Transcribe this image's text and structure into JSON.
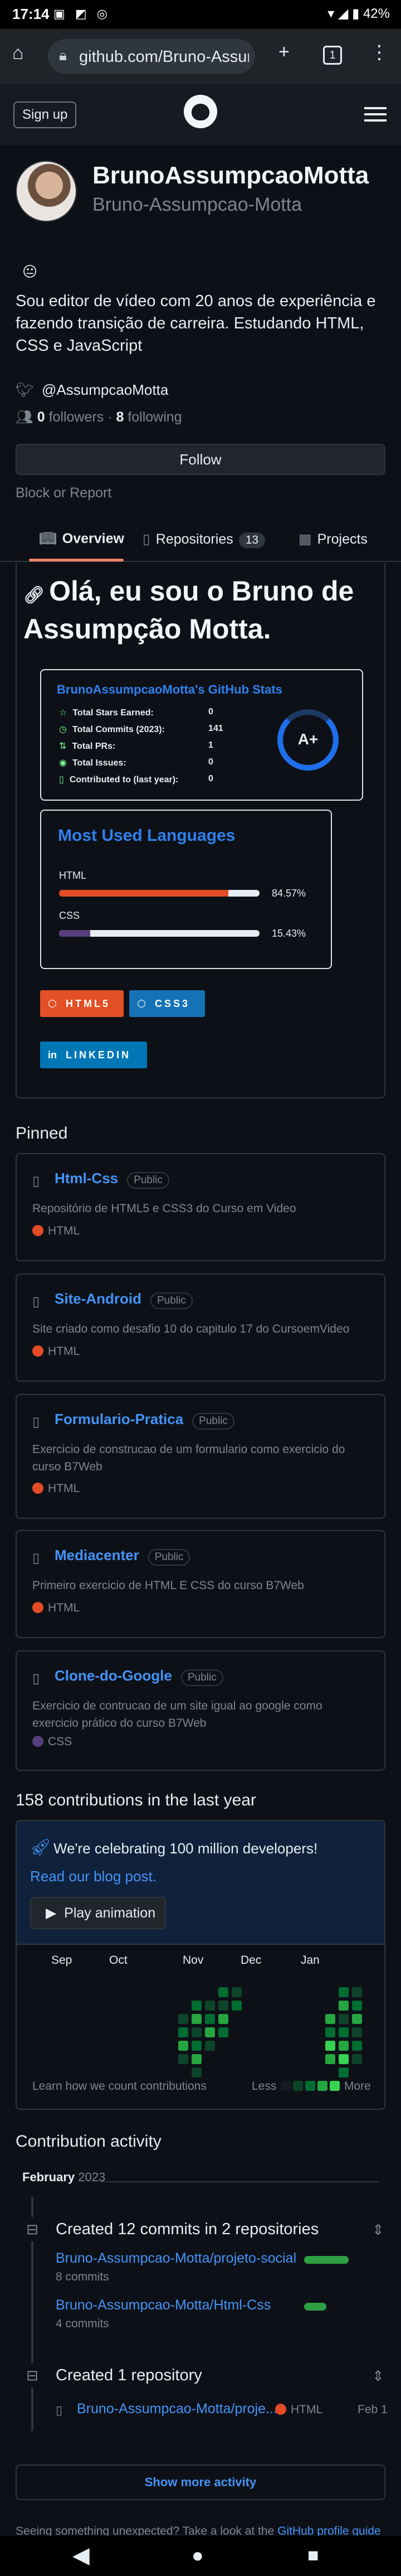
{
  "status_bar": {
    "time": "17:14",
    "battery": "42%"
  },
  "browser": {
    "url": "github.com/Bruno-Assum",
    "tab_count": "1"
  },
  "header": {
    "signup_label": "Sign up"
  },
  "profile": {
    "name": "BrunoAssumpcaoMotta",
    "login": "Bruno-Assumpcao-Motta",
    "status_emoji": "😐",
    "bio": "Sou editor de vídeo com 20 anos de experiência e fazendo transição de carreira. Estudando HTML, CSS e JavaScript",
    "twitter": "@AssumpcaoMotta",
    "followers_count": "0",
    "followers_label": "followers",
    "following_count": "8",
    "following_label": "following",
    "follow_button": "Follow",
    "block_report": "Block or Report"
  },
  "tabs": [
    {
      "label": "Overview",
      "active": true
    },
    {
      "label": "Repositories",
      "count": "13"
    },
    {
      "label": "Projects"
    }
  ],
  "readme": {
    "title": "Olá, eu sou o Bruno de Assumpção Motta.",
    "stats_card": {
      "title": "BrunoAssumpcaoMotta's GitHub Stats",
      "rows": [
        {
          "label": "Total Stars Earned:",
          "value": "0"
        },
        {
          "label": "Total Commits (2023):",
          "value": "141"
        },
        {
          "label": "Total PRs:",
          "value": "1"
        },
        {
          "label": "Total Issues:",
          "value": "0"
        },
        {
          "label": "Contributed to (last year):",
          "value": "0"
        }
      ],
      "grade": "A+"
    },
    "languages_card": {
      "title": "Most Used Languages",
      "languages": [
        {
          "name": "HTML",
          "percent": "84.57%",
          "fraction": 0.8457,
          "color": "#e34c26"
        },
        {
          "name": "CSS",
          "percent": "15.43%",
          "fraction": 0.1543,
          "color": "#563d7c"
        }
      ]
    },
    "badges": [
      {
        "label": "HTML5",
        "color": "#e34f26",
        "icon": "html5-icon"
      },
      {
        "label": "CSS3",
        "color": "#1572b6",
        "icon": "css3-icon"
      },
      {
        "label": "LINKEDIN",
        "color": "#0077b5",
        "icon": "linkedin-icon"
      }
    ]
  },
  "pinned": {
    "heading": "Pinned",
    "visibility_label": "Public",
    "items": [
      {
        "name": "Html-Css",
        "description": "Repositório de HTML5 e CSS3 do Curso em Video",
        "language": "HTML",
        "lang_color": "#e34c26"
      },
      {
        "name": "Site-Android",
        "description": "Site criado como desafio 10 do capitulo 17 do CursoemVideo",
        "language": "HTML",
        "lang_color": "#e34c26"
      },
      {
        "name": "Formulario-Pratica",
        "description": "Exercicio de construcao de um formulario como exercicio do curso B7Web",
        "language": "HTML",
        "lang_color": "#e34c26"
      },
      {
        "name": "Mediacenter",
        "description": "Primeiro exercicio de HTML E CSS do curso B7Web",
        "language": "HTML",
        "lang_color": "#e34c26"
      },
      {
        "name": "Clone-do-Google",
        "description": "Exercicio de contrucao de um site igual ao google como exercicio prático do curso B7Web",
        "language": "CSS",
        "lang_color": "#563d7c"
      }
    ]
  },
  "contributions": {
    "heading": "158 contributions in the last year",
    "banner_title": "We're celebrating 100 million developers!",
    "banner_link": "Read our blog post.",
    "play_button": "Play animation",
    "months": [
      "Sep",
      "Oct",
      "Nov",
      "Dec",
      "Jan"
    ],
    "learn_link": "Learn how we count contributions",
    "less_label": "Less",
    "more_label": "More"
  },
  "activity": {
    "heading": "Contribution activity",
    "month": "February",
    "year": "2023",
    "commits_heading": "Created 12 commits in 2 repositories",
    "commit_repos": [
      {
        "name": "Bruno-Assumpcao-Motta/projeto-social",
        "commits": "8 commits",
        "fraction": 0.67
      },
      {
        "name": "Bruno-Assumpcao-Motta/Html-Css",
        "commits": "4 commits",
        "fraction": 0.33
      }
    ],
    "repo_heading": "Created 1 repository",
    "created_repo": {
      "name": "Bruno-Assumpcao-Motta/proje...",
      "language": "HTML",
      "date": "Feb 1"
    },
    "show_more": "Show more activity",
    "footnote_text": "Seeing something unexpected? Take a look at the",
    "footnote_link": "GitHub profile guide"
  }
}
